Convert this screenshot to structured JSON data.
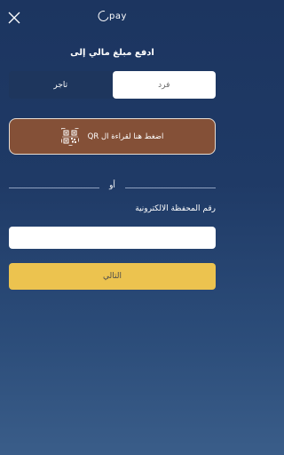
{
  "header": {
    "close_icon": "close-icon",
    "logo_text": "pay"
  },
  "title": "ادفع مبلغ مالي إلى",
  "segments": [
    {
      "label": "تاجر",
      "active": false
    },
    {
      "label": "فرد",
      "active": true
    }
  ],
  "qr_button": {
    "label": "اضغط هنا لقراءة ال QR",
    "icon": "qr-code-icon"
  },
  "divider": {
    "text": "أو"
  },
  "wallet": {
    "label": "رقم المحفظة الالكترونية",
    "value": "",
    "placeholder": ""
  },
  "next_button": {
    "label": "التالي"
  },
  "colors": {
    "background": "#1f3a66",
    "segment_bg": "#1e365d",
    "qr_button": "#845037",
    "next_button": "#ecc34f"
  }
}
